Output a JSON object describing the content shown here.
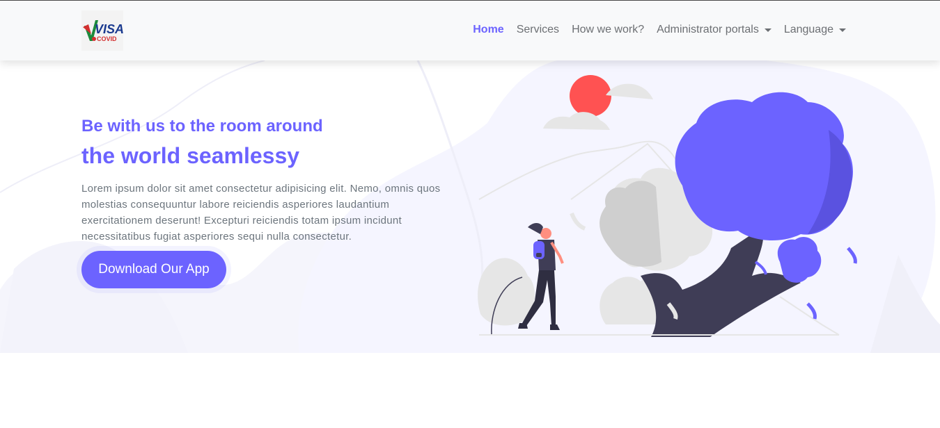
{
  "brand": {
    "logo_text": "VISA",
    "logo_subtext": "COVID"
  },
  "nav": {
    "items": [
      {
        "label": "Home",
        "active": true
      },
      {
        "label": "Services",
        "active": false
      },
      {
        "label": "How we work?",
        "active": false
      },
      {
        "label": "Administrator portals",
        "dropdown": true
      },
      {
        "label": "Language",
        "dropdown": true
      }
    ]
  },
  "hero": {
    "heading_line1": "Be with us to the room around",
    "heading_line2": "the world seamlessy",
    "description": "Lorem ipsum dolor sit amet consectetur adipisicing elit. Nemo, omnis quos molestias consequuntur labore reiciendis asperiores laudantium exercitationem deserunt! Excepturi reiciendis totam ipsum incidunt necessitatibus fugiat asperiores sequi nulla consectetur.",
    "cta_label": "Download Our App"
  },
  "colors": {
    "accent": "#6c63ff",
    "sun": "#ff5252",
    "tree_trunk": "#3f3d56",
    "hero_bg_shape": "#f5f5ff"
  },
  "icons": {
    "dropdown": "caret-down-icon",
    "illustration": "traveler-trees-illustration"
  }
}
